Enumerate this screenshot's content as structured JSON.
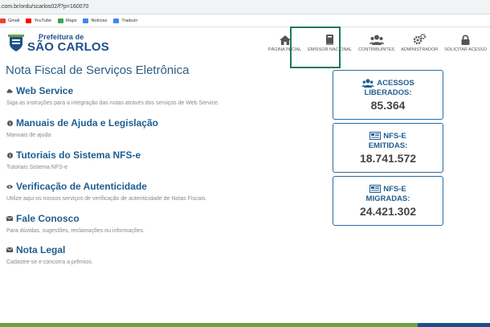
{
  "browser": {
    "url": ".com.br/ordu/scarlos02/f?p=160070",
    "bookmarks": [
      {
        "label": "Gmail",
        "color": "#ea4335"
      },
      {
        "label": "YouTube",
        "color": "#ff0000"
      },
      {
        "label": "Maps",
        "color": "#34a853"
      },
      {
        "label": "Notícias",
        "color": "#4285f4"
      },
      {
        "label": "Traduzir",
        "color": "#4285f4"
      }
    ]
  },
  "logo": {
    "small": "Prefeitura de",
    "big": "SÃO CARLOS"
  },
  "nav": [
    {
      "label": "PÁGINA INICIAL",
      "icon": "home-icon"
    },
    {
      "label": "EMISSOR NACIONAL",
      "icon": "book-icon"
    },
    {
      "label": "CONTRIBUINTES",
      "icon": "users-icon"
    },
    {
      "label": "ADMINISTRADOR",
      "icon": "gears-icon"
    },
    {
      "label": "SOLICITAR ACESSO",
      "icon": "lock-icon"
    }
  ],
  "main": {
    "title": "Nota Fiscal de Serviços Eletrônica",
    "sections": [
      {
        "title": "Web Service",
        "subtitle": "Siga as instruções para a integração das notas através dos serviços de Web Service.",
        "icon": "cloud-icon"
      },
      {
        "title": "Manuais de Ajuda e Legislação",
        "subtitle": "Manuais de ajuda",
        "icon": "info-icon"
      },
      {
        "title": "Tutoriais do Sistema NFS-e",
        "subtitle": "Tutoriais Sistema NFS-e",
        "icon": "info-icon"
      },
      {
        "title": "Verificação de Autenticidade",
        "subtitle": "Utilize aqui os nossos serviços de verificação de autenticidade de Notas Fiscais.",
        "icon": "eye-icon"
      },
      {
        "title": "Fale Conosco",
        "subtitle": "Para dúvidas, sugestões, reclamações ou informações.",
        "icon": "envelope-icon"
      },
      {
        "title": "Nota Legal",
        "subtitle": "Cadastre-se e concorra a prêmios.",
        "icon": "envelope-icon"
      }
    ]
  },
  "stats": [
    {
      "line1": "ACESSOS",
      "line2": "LIBERADOS:",
      "value": "85.364",
      "icon": "users-icon"
    },
    {
      "line1": "NFS-E",
      "line2": "EMITIDAS:",
      "value": "18.741.572",
      "icon": "newspaper-icon"
    },
    {
      "line1": "NFS-E",
      "line2": "MIGRADAS:",
      "value": "24.421.302",
      "icon": "newspaper-icon"
    }
  ],
  "colors": {
    "brand": "#1e4f8b",
    "link": "#1f5d8f",
    "highlight": "#1a7a52",
    "footer": "#6aa341"
  }
}
